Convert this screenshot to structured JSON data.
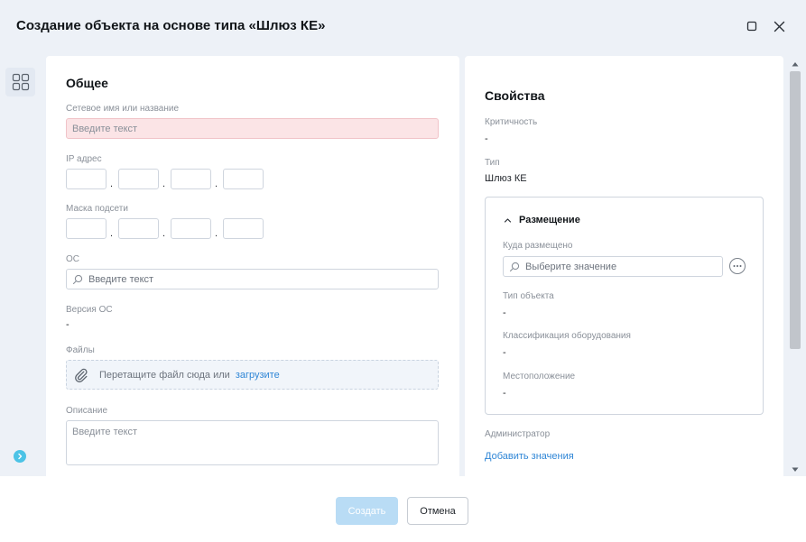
{
  "dialog": {
    "title": "Создание объекта на основе типа «Шлюз КЕ»"
  },
  "general": {
    "section_title": "Общее",
    "name_label": "Сетевое имя или название",
    "name_placeholder": "Введите текст",
    "ip_label": "IP адрес",
    "ip_dot": ".",
    "mask_label": "Маска подсети",
    "os_label": "ОС",
    "os_placeholder": "Введите текст",
    "os_version_label": "Версия ОС",
    "os_version_value": "-",
    "files_label": "Файлы",
    "files_drop_text": "Перетащите файл сюда или",
    "files_upload_link": "загрузите",
    "description_label": "Описание",
    "description_placeholder": "Введите текст"
  },
  "properties": {
    "section_title": "Свойства",
    "criticality_label": "Критичность",
    "criticality_value": "-",
    "type_label": "Тип",
    "type_value": "Шлюз КЕ",
    "placement": {
      "title": "Размещение",
      "location_label": "Куда размещено",
      "location_placeholder": "Выберите значение",
      "object_type_label": "Тип объекта",
      "object_type_value": "-",
      "equipment_class_label": "Классификация оборудования",
      "equipment_class_value": "-",
      "position_label": "Местоположение",
      "position_value": "-"
    },
    "admin_label": "Администратор",
    "admin_add_link": "Добавить значения"
  },
  "footer": {
    "create_label": "Создать",
    "cancel_label": "Отмена"
  },
  "icons": {
    "rail": "grid-icon",
    "expand": "chevron-right-icon",
    "maximize": "maximize-icon",
    "close": "close-icon",
    "search": "search-icon",
    "attach": "paperclip-icon",
    "collapse": "chevron-up-icon",
    "more": "more-icon"
  },
  "colors": {
    "header_bg": "#edf1f7",
    "error_input_bg": "#fbe4e6",
    "link": "#2f86d6",
    "primary_disabled": "#b9dcf5",
    "rail_expand": "#4cc3e6"
  }
}
